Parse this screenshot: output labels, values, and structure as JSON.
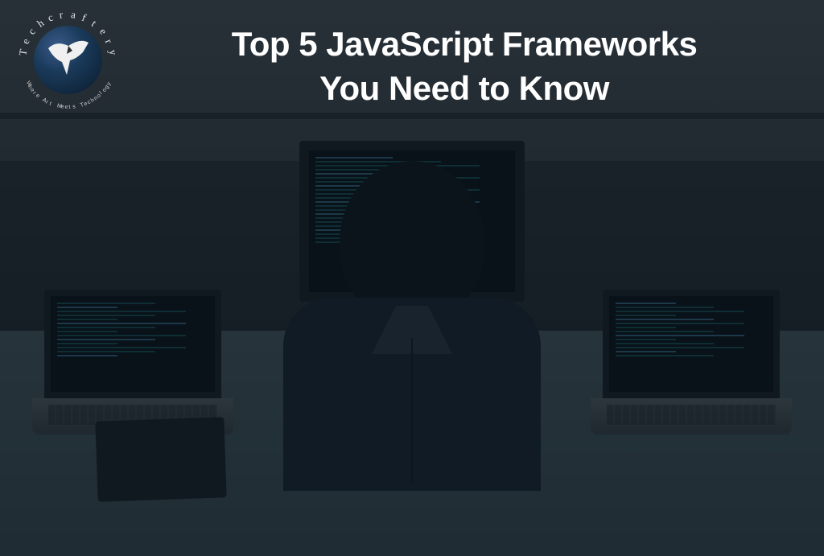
{
  "hero": {
    "title_line1": "Top 5 JavaScript Frameworks",
    "title_line2": "You Need to Know"
  },
  "logo": {
    "brand_name": "Techcraftery",
    "tagline": "Where Art Meets Technology"
  }
}
